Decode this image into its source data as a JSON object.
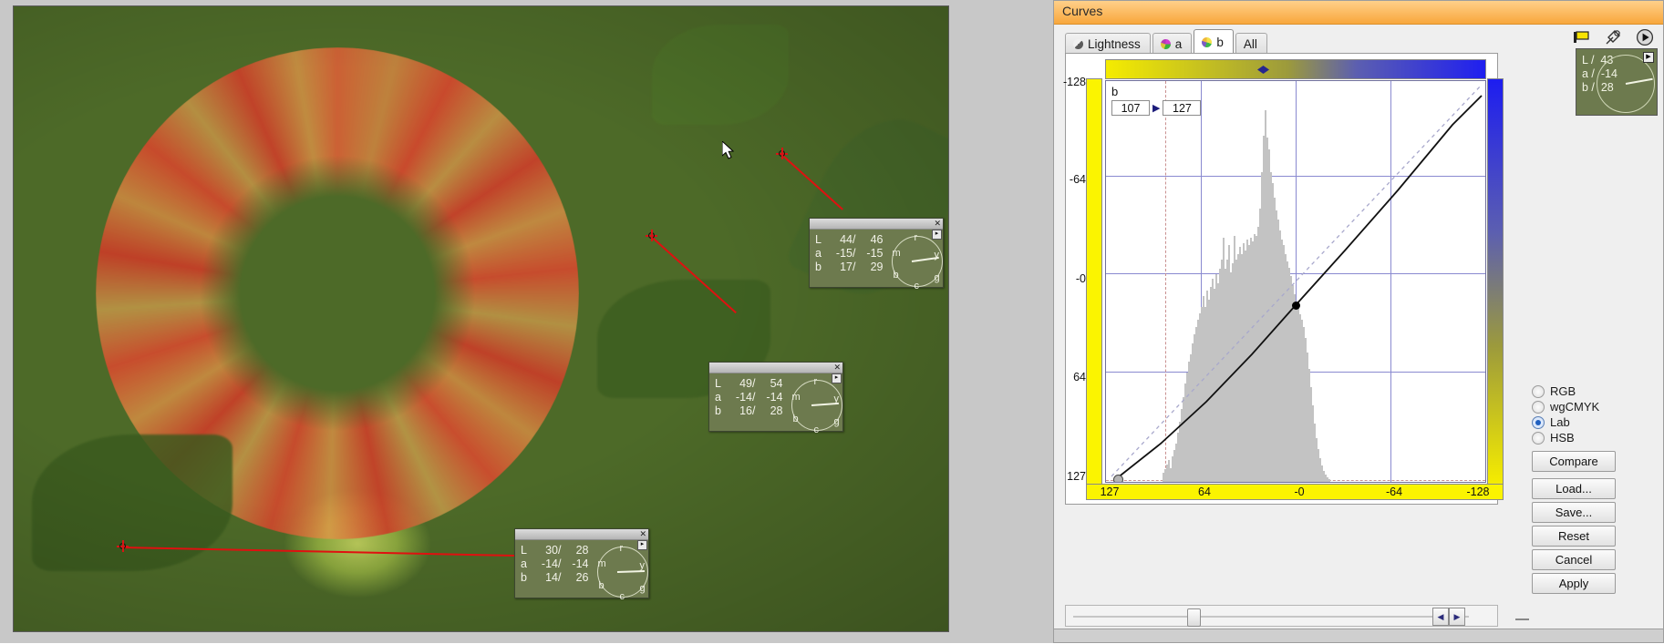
{
  "window": {
    "title": "Curves"
  },
  "tabs": [
    {
      "label": "Lightness",
      "icon": "lightness-swatch-icon",
      "active": false
    },
    {
      "label": "a",
      "icon": "channel-a-swatch-icon",
      "active": false
    },
    {
      "label": "b",
      "icon": "channel-b-swatch-icon",
      "active": true
    },
    {
      "label": "All",
      "icon": "",
      "active": false
    }
  ],
  "toolbar_icons": [
    {
      "name": "flag-icon"
    },
    {
      "name": "eyedropper-icon"
    },
    {
      "name": "play-icon"
    }
  ],
  "info_box": {
    "lines": [
      "L /  43",
      "a /  -14",
      "b /  28"
    ],
    "L": "43",
    "a": "-14",
    "b": "28",
    "expand_glyph": "▶"
  },
  "value_editor": {
    "channel_label": "b",
    "input_value": "107",
    "output_value": "127",
    "arrow_glyph": "▶"
  },
  "chart_data": {
    "type": "line",
    "title": "b channel curve",
    "xlabel": "",
    "ylabel": "",
    "x_ticks": [
      "127",
      "64",
      "-0",
      "-64",
      "-128"
    ],
    "y_ticks": [
      "-128",
      "-64",
      "-0",
      "64",
      "127"
    ],
    "xlim": [
      127,
      -128
    ],
    "ylim": [
      -128,
      127
    ],
    "grid": true,
    "series": [
      {
        "name": "identity-reference",
        "style": "dashed",
        "points": [
          [
            127,
            127
          ],
          [
            -128,
            -128
          ]
        ]
      },
      {
        "name": "b-curve",
        "style": "solid",
        "points": [
          [
            127,
            127
          ],
          [
            107,
            119
          ],
          [
            20,
            10
          ],
          [
            -45,
            -60
          ],
          [
            -128,
            -128
          ]
        ]
      }
    ],
    "control_points": [
      {
        "x": 127,
        "y": 127,
        "selected": false
      },
      {
        "x": 20,
        "y": 10,
        "selected": true
      }
    ],
    "histogram_note": "gray luminosity histogram of b channel, tall narrow spike near center-right with broad lower lobe",
    "gradients": {
      "top_bar": "yellow-to-blue",
      "left_bar": "yellow",
      "right_bar": "blue-to-yellow",
      "bottom_bar": "yellow"
    }
  },
  "color_space": {
    "options": [
      {
        "label": "RGB",
        "selected": false
      },
      {
        "label": "wgCMYK",
        "selected": false
      },
      {
        "label": "Lab",
        "selected": true
      },
      {
        "label": "HSB",
        "selected": false
      }
    ]
  },
  "buttons": [
    {
      "label": "Compare"
    },
    {
      "label": "Load..."
    },
    {
      "label": "Save..."
    },
    {
      "label": "Reset"
    },
    {
      "label": "Cancel"
    },
    {
      "label": "Apply"
    }
  ],
  "slider": {
    "value_position_pct": 29,
    "left_arrow": "◀",
    "right_arrow": "▶",
    "dash_label": "—"
  },
  "image_readouts": [
    {
      "id": "readout-1",
      "rows": [
        {
          "channel": "L",
          "before": "44",
          "after": "46"
        },
        {
          "channel": "a",
          "before": "-15",
          "after": "-15"
        },
        {
          "channel": "b",
          "before": "17",
          "after": "29"
        }
      ],
      "wheel_labels": [
        "r",
        "y",
        "g",
        "c",
        "b",
        "m"
      ],
      "close_glyph": "✕"
    },
    {
      "id": "readout-2",
      "rows": [
        {
          "channel": "L",
          "before": "49",
          "after": "54"
        },
        {
          "channel": "a",
          "before": "-14",
          "after": "-14"
        },
        {
          "channel": "b",
          "before": "16",
          "after": "28"
        }
      ],
      "wheel_labels": [
        "r",
        "y",
        "g",
        "c",
        "b",
        "m"
      ],
      "close_glyph": "✕"
    },
    {
      "id": "readout-3",
      "rows": [
        {
          "channel": "L",
          "before": "30",
          "after": "28"
        },
        {
          "channel": "a",
          "before": "-14",
          "after": "-14"
        },
        {
          "channel": "b",
          "before": "14",
          "after": "26"
        }
      ],
      "wheel_labels": [
        "r",
        "y",
        "g",
        "c",
        "b",
        "m"
      ],
      "close_glyph": "✕"
    }
  ],
  "colors": {
    "title_bar_start": "#ffd08a",
    "title_bar_end": "#f8a73c",
    "readout_bg": "#6d7a4e",
    "accent_yellow": "#fbf400",
    "accent_blue": "#1d1df0",
    "sample_line": "#e01010",
    "grid": "#8a8ad0"
  }
}
